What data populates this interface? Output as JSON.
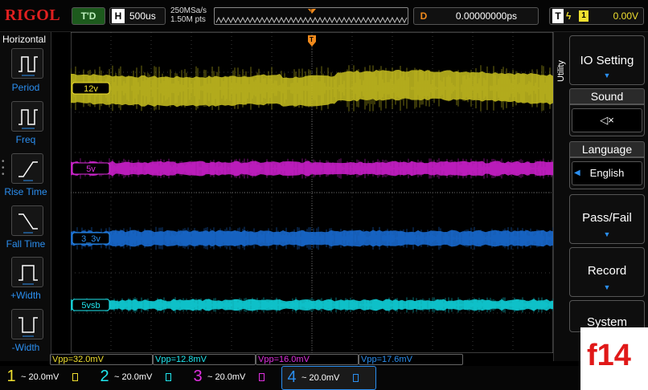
{
  "brand": "RIGOL",
  "topbar": {
    "trigger_status": "T'D",
    "timebase_key": "H",
    "timebase": "500us",
    "sample_rate": "250MSa/s",
    "mem_depth": "1.50M pts",
    "delay_key": "D",
    "delay": "0.00000000ps",
    "trig_key": "T",
    "trig_edge_icon": "rising-edge-icon",
    "trig_source": "1",
    "trig_level": "0.00V"
  },
  "left_panel": {
    "title": "Horizontal",
    "items": [
      {
        "label": "Period",
        "icon": "period-icon"
      },
      {
        "label": "Freq",
        "icon": "freq-icon"
      },
      {
        "label": "Rise Time",
        "icon": "rise-time-icon"
      },
      {
        "label": "Fall Time",
        "icon": "fall-time-icon"
      },
      {
        "label": "+Width",
        "icon": "pos-width-icon"
      },
      {
        "label": "-Width",
        "icon": "neg-width-icon"
      }
    ]
  },
  "waveforms": [
    {
      "channel": "1",
      "label": "12v",
      "color": "#c8c020",
      "marker_color": "#f0e030"
    },
    {
      "channel": "3",
      "label": "5v",
      "color": "#d020d0",
      "marker_color": "#e030e0"
    },
    {
      "channel": "4",
      "label": "3_3v",
      "color": "#1a6fd8",
      "marker_color": "#2b8ff0"
    },
    {
      "channel": "2",
      "label": "5vsb",
      "color": "#10d8e0",
      "marker_color": "#20e8f0"
    }
  ],
  "right_menu": {
    "tab": "Utility",
    "items": [
      {
        "title": "IO Setting"
      },
      {
        "title": "Sound",
        "value_icon": "speaker-mute-icon"
      },
      {
        "title": "Language",
        "value": "English"
      },
      {
        "title": "Pass/Fail"
      },
      {
        "title": "Record"
      },
      {
        "title": "System"
      }
    ]
  },
  "measurements": [
    {
      "text": "Vpp=32.0mV",
      "color": "#f0e030"
    },
    {
      "text": "Vpp=12.8mV",
      "color": "#20e8f0"
    },
    {
      "text": "Vpp=16.0mV",
      "color": "#e030e0"
    },
    {
      "text": "Vpp=17.6mV",
      "color": "#2b8ff0"
    }
  ],
  "channels": [
    {
      "num": "1",
      "scale": "~ 20.0mV",
      "color": "#f0e030"
    },
    {
      "num": "2",
      "scale": "~ 20.0mV",
      "color": "#20e8f0"
    },
    {
      "num": "3",
      "scale": "~ 20.0mV",
      "color": "#e030e0"
    },
    {
      "num": "4",
      "scale": "~ 20.0mV",
      "color": "#2b8ff0"
    }
  ],
  "overlay_label": "f14"
}
